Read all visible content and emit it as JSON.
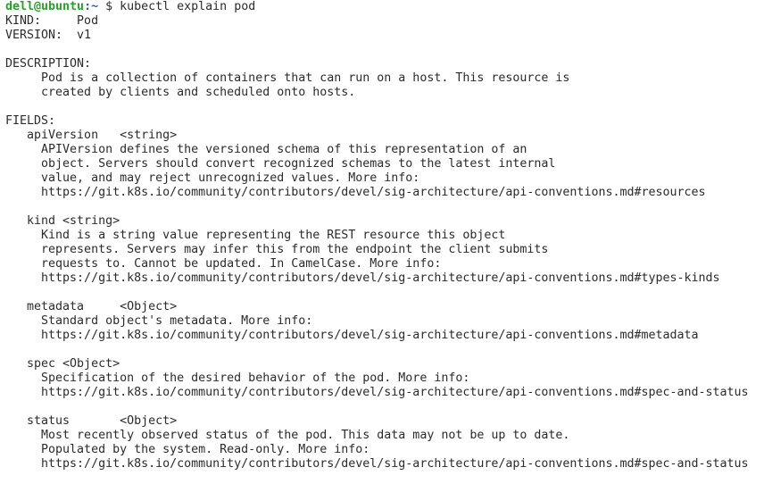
{
  "prompt": {
    "user_host": "dell@ubuntu",
    "path": ":~",
    "symbol": " $ ",
    "command": "kubectl explain pod"
  },
  "lines": [
    "KIND:     Pod",
    "VERSION:  v1",
    "",
    "DESCRIPTION:",
    "     Pod is a collection of containers that can run on a host. This resource is",
    "     created by clients and scheduled onto hosts.",
    "",
    "FIELDS:",
    "   apiVersion   <string>",
    "     APIVersion defines the versioned schema of this representation of an",
    "     object. Servers should convert recognized schemas to the latest internal",
    "     value, and may reject unrecognized values. More info:",
    "     https://git.k8s.io/community/contributors/devel/sig-architecture/api-conventions.md#resources",
    "",
    "   kind <string>",
    "     Kind is a string value representing the REST resource this object",
    "     represents. Servers may infer this from the endpoint the client submits",
    "     requests to. Cannot be updated. In CamelCase. More info:",
    "     https://git.k8s.io/community/contributors/devel/sig-architecture/api-conventions.md#types-kinds",
    "",
    "   metadata     <Object>",
    "     Standard object's metadata. More info:",
    "     https://git.k8s.io/community/contributors/devel/sig-architecture/api-conventions.md#metadata",
    "",
    "   spec <Object>",
    "     Specification of the desired behavior of the pod. More info:",
    "     https://git.k8s.io/community/contributors/devel/sig-architecture/api-conventions.md#spec-and-status",
    "",
    "   status       <Object>",
    "     Most recently observed status of the pod. This data may not be up to date.",
    "     Populated by the system. Read-only. More info:",
    "     https://git.k8s.io/community/contributors/devel/sig-architecture/api-conventions.md#spec-and-status"
  ]
}
